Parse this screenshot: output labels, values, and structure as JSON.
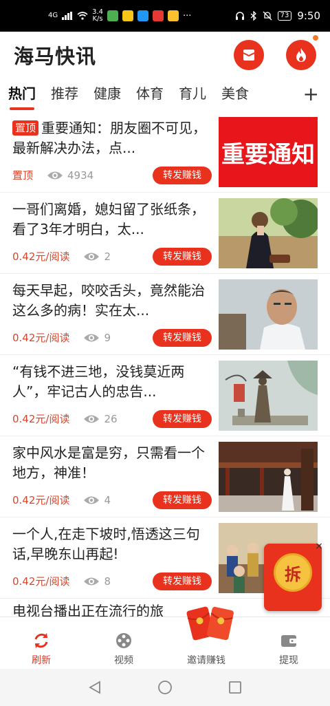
{
  "status_bar": {
    "network": "4G",
    "speed": "3.4\nK/s",
    "dots": "···",
    "battery": "73",
    "time": "9:50"
  },
  "header": {
    "app_title": "海马快讯"
  },
  "tabs": [
    {
      "label": "热门",
      "active": true
    },
    {
      "label": "推荐"
    },
    {
      "label": "健康"
    },
    {
      "label": "体育"
    },
    {
      "label": "育儿"
    },
    {
      "label": "美食"
    }
  ],
  "tab_add": "+",
  "feed": [
    {
      "tag": "置顶",
      "title": "重要通知：朋友圈不可见，最新解决办法，点...",
      "meta_left": "置顶",
      "views": "4934",
      "share": "转发赚钱",
      "thumb_text": "重要通知"
    },
    {
      "title": "一哥们离婚，媳妇留了张纸条，看了3年才明白，太...",
      "meta_left": "0.42元/阅读",
      "views": "2",
      "share": "转发赚钱"
    },
    {
      "title": "每天早起，咬咬舌头，竟然能治这么多的病！实在太...",
      "meta_left": "0.42元/阅读",
      "views": "9",
      "share": "转发赚钱"
    },
    {
      "title": "“有钱不进三地，没钱莫近两人”，牢记古人的忠告...",
      "meta_left": "0.42元/阅读",
      "views": "26",
      "share": "转发赚钱"
    },
    {
      "title": "家中风水是富是穷，只需看一个地方，神准！",
      "meta_left": "0.42元/阅读",
      "views": "4",
      "share": "转发赚钱"
    },
    {
      "title": "一个人,在走下坡时,悟透这三句话,早晚东山再起!",
      "meta_left": "0.42元/阅读",
      "views": "8",
      "share": "转发赚钱"
    }
  ],
  "partial_item_title": "电视台播出正在流行的旅",
  "float_packet": {
    "label": "拆",
    "close": "×"
  },
  "bottom_nav": [
    {
      "label": "刷新",
      "icon": "refresh-icon",
      "active": true
    },
    {
      "label": "视频",
      "icon": "video-icon"
    },
    {
      "label": "邀请赚钱",
      "icon": "red-packet-icon"
    },
    {
      "label": "提现",
      "icon": "wallet-icon"
    }
  ],
  "colors": {
    "accent": "#e8321d",
    "price": "#d9452a"
  }
}
